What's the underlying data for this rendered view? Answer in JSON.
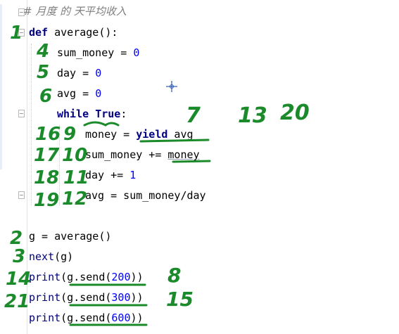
{
  "editor": {
    "comment": "# 月度 的 天平均收入",
    "lines": [
      {
        "parts": [
          {
            "cls": "kw",
            "t": "def"
          },
          {
            "cls": "",
            "t": " average():"
          }
        ]
      },
      {
        "parts": [
          {
            "cls": "",
            "t": "sum_money = "
          },
          {
            "cls": "num",
            "t": "0"
          }
        ]
      },
      {
        "parts": [
          {
            "cls": "",
            "t": "day = "
          },
          {
            "cls": "num",
            "t": "0"
          }
        ]
      },
      {
        "parts": [
          {
            "cls": "",
            "t": "avg = "
          },
          {
            "cls": "num",
            "t": "0"
          }
        ]
      },
      {
        "parts": [
          {
            "cls": "kw",
            "t": "while"
          },
          {
            "cls": "",
            "t": " "
          },
          {
            "cls": "kw",
            "t": "True"
          },
          {
            "cls": "",
            "t": ":"
          }
        ]
      },
      {
        "parts": [
          {
            "cls": "",
            "t": "money = "
          },
          {
            "cls": "kw",
            "t": "yield"
          },
          {
            "cls": "",
            "t": " avg"
          }
        ]
      },
      {
        "parts": [
          {
            "cls": "",
            "t": "sum_money += "
          },
          {
            "cls": "",
            "t": "money"
          }
        ]
      },
      {
        "parts": [
          {
            "cls": "",
            "t": "day += "
          },
          {
            "cls": "num",
            "t": "1"
          }
        ]
      },
      {
        "parts": [
          {
            "cls": "",
            "t": "avg = sum_money/day"
          }
        ]
      },
      {
        "parts": [
          {
            "cls": "",
            "t": "g = average()"
          }
        ]
      },
      {
        "parts": [
          {
            "cls": "builtin",
            "t": "next"
          },
          {
            "cls": "",
            "t": "(g)"
          }
        ]
      },
      {
        "parts": [
          {
            "cls": "builtin",
            "t": "print"
          },
          {
            "cls": "",
            "t": "(g.send("
          },
          {
            "cls": "num",
            "t": "200"
          },
          {
            "cls": "",
            "t": "))"
          }
        ]
      },
      {
        "parts": [
          {
            "cls": "builtin",
            "t": "print"
          },
          {
            "cls": "",
            "t": "(g.send("
          },
          {
            "cls": "num",
            "t": "300"
          },
          {
            "cls": "",
            "t": "))"
          }
        ]
      },
      {
        "parts": [
          {
            "cls": "builtin",
            "t": "print"
          },
          {
            "cls": "",
            "t": "(g.send("
          },
          {
            "cls": "num",
            "t": "600"
          },
          {
            "cls": "",
            "t": "))"
          }
        ]
      }
    ]
  },
  "annotations": {
    "left_numbers": [
      "1",
      "4",
      "5",
      "6",
      "16",
      "9",
      "17",
      "10",
      "18",
      "11",
      "19",
      "12",
      "2",
      "3",
      "14",
      "21"
    ],
    "right_numbers": [
      "7",
      "13",
      "20",
      "8",
      "15"
    ]
  },
  "colors": {
    "keyword": "#000080",
    "number": "#0000ff",
    "comment": "#808080",
    "handwriting": "#1a8a2a"
  }
}
